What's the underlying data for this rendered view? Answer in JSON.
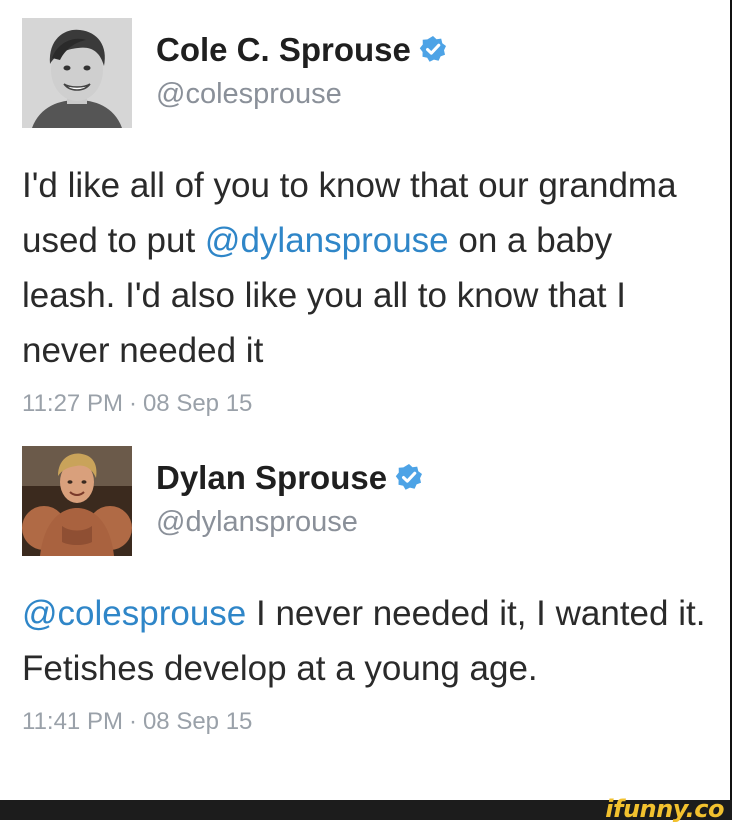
{
  "tweets": [
    {
      "display_name": "Cole C. Sprouse",
      "handle": "@colesprouse",
      "text_parts": [
        {
          "text": "I'd like all of you to know that our grandma used to put ",
          "mention": false
        },
        {
          "text": "@dylansprouse",
          "mention": true
        },
        {
          "text": " on a baby leash. I'd also like you all to know that I never needed it",
          "mention": false
        }
      ],
      "time": "11:27 PM",
      "date": "08 Sep 15",
      "avatar_icon": "person-portrait",
      "verified_icon": "verified-badge-icon"
    },
    {
      "display_name": "Dylan Sprouse",
      "handle": "@dylansprouse",
      "text_parts": [
        {
          "text": "@colesprouse",
          "mention": true
        },
        {
          "text": " I never needed it, I wanted it. Fetishes develop at a young age.",
          "mention": false
        }
      ],
      "time": "11:41 PM",
      "date": "08 Sep 15",
      "avatar_icon": "muscular-person-portrait",
      "verified_icon": "verified-badge-icon"
    }
  ],
  "timestamp_separator": "·",
  "watermark": "ifunny.co",
  "colors": {
    "mention": "#2f86c8",
    "handle": "#8a9099",
    "timestamp": "#9aa1a9",
    "verified": "#4da3e6",
    "watermark": "#f2c12e",
    "bottom_bar": "#1c1c1c"
  }
}
